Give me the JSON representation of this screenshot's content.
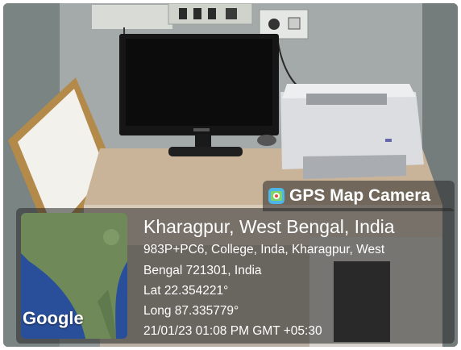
{
  "badge": {
    "app_name": "GPS Map Camera",
    "icon": "gps-map-camera-app-icon"
  },
  "mini_map": {
    "logo_text": "Google",
    "colors": {
      "land": "#6f8a58",
      "sea": "#2a4f9a"
    }
  },
  "location": {
    "title": "Kharagpur, West Bengal, India",
    "address_line_1": "983P+PC6, College, Inda, Kharagpur, West",
    "address_line_2": "Bengal 721301, India",
    "lat": "Lat 22.354221°",
    "long": "Long 87.335779°",
    "timestamp": "21/01/23 01:08 PM GMT +05:30"
  },
  "scene": {
    "objects": [
      "desktop monitor",
      "laser printer",
      "whiteboard",
      "wooden computer desk",
      "power switchboard",
      "cpu tower"
    ]
  }
}
